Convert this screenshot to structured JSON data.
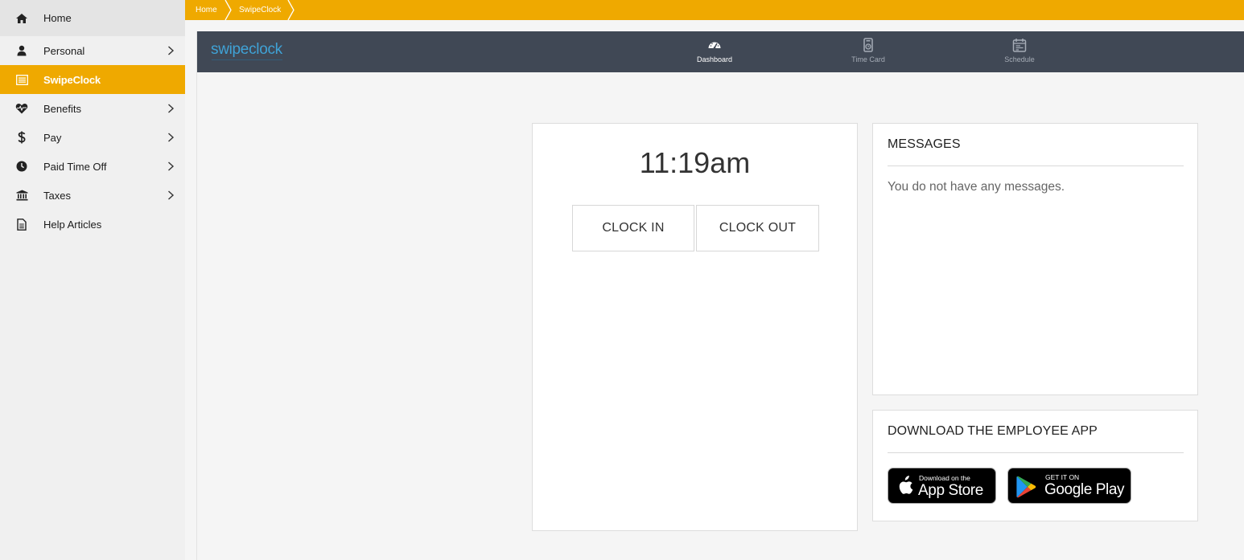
{
  "sidebar": {
    "items": [
      {
        "label": "Home",
        "icon": "home-icon",
        "chevron": false
      },
      {
        "label": "Personal",
        "icon": "user-icon",
        "chevron": true
      },
      {
        "label": "SwipeClock",
        "icon": "list-icon",
        "chevron": false,
        "active": true
      },
      {
        "label": "Benefits",
        "icon": "heartbeat-icon",
        "chevron": true
      },
      {
        "label": "Pay",
        "icon": "dollar-icon",
        "chevron": true
      },
      {
        "label": "Paid Time Off",
        "icon": "clock-icon",
        "chevron": true
      },
      {
        "label": "Taxes",
        "icon": "bank-icon",
        "chevron": true
      },
      {
        "label": "Help Articles",
        "icon": "document-icon",
        "chevron": false
      }
    ]
  },
  "breadcrumb": {
    "items": [
      "Home",
      "SwipeClock"
    ]
  },
  "topnav": {
    "logo": "swipeclock",
    "tabs": [
      {
        "label": "Dashboard",
        "icon": "speedometer-icon",
        "active": true
      },
      {
        "label": "Time Card",
        "icon": "timecard-icon",
        "active": false
      },
      {
        "label": "Schedule",
        "icon": "calendar-icon",
        "active": false
      }
    ]
  },
  "clock": {
    "time": "11:19am",
    "clock_in_label": "CLOCK IN",
    "clock_out_label": "CLOCK OUT"
  },
  "messages": {
    "title": "MESSAGES",
    "empty_text": "You do not have any messages."
  },
  "download": {
    "title": "DOWNLOAD THE EMPLOYEE APP",
    "app_store": {
      "small": "Download on the",
      "big": "App Store"
    },
    "google_play": {
      "small": "GET IT ON",
      "big": "Google Play"
    }
  },
  "colors": {
    "accent": "#efa900",
    "nav_bg": "#404855",
    "logo": "#3fa2d6"
  }
}
